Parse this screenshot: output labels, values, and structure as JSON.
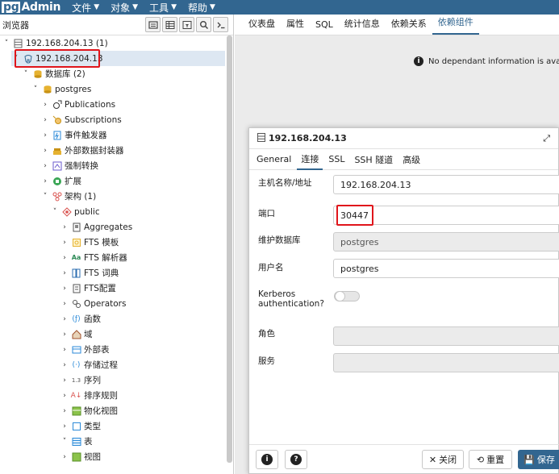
{
  "app": {
    "logo_prefix": "pg",
    "logo_rest": "Admin",
    "menus": [
      "文件",
      "对象",
      "工具",
      "帮助"
    ]
  },
  "browser": {
    "title": "浏览器",
    "tree": [
      {
        "label": "192.168.204.13 (1)",
        "icon": "server-group-icon",
        "level": 0,
        "expanded": true
      },
      {
        "label": "192.168.204.13",
        "icon": "elephant-server-icon",
        "level": 1,
        "expanded": true,
        "selected": true
      },
      {
        "label": "数据库 (2)",
        "icon": "databases-icon",
        "level": 2,
        "expanded": true
      },
      {
        "label": "postgres",
        "icon": "database-icon",
        "level": 3,
        "expanded": true
      },
      {
        "label": "Publications",
        "icon": "publications-icon",
        "level": 4,
        "expanded": false
      },
      {
        "label": "Subscriptions",
        "icon": "subscriptions-icon",
        "level": 4,
        "expanded": false
      },
      {
        "label": "事件触发器",
        "icon": "event-trigger-icon",
        "level": 4,
        "expanded": false
      },
      {
        "label": "外部数据封装器",
        "icon": "foreign-data-wrapper-icon",
        "level": 4,
        "expanded": false
      },
      {
        "label": "强制转换",
        "icon": "cast-icon",
        "level": 4,
        "expanded": false
      },
      {
        "label": "扩展",
        "icon": "extension-icon",
        "level": 4,
        "expanded": false
      },
      {
        "label": "架构 (1)",
        "icon": "schemas-icon",
        "level": 4,
        "expanded": true
      },
      {
        "label": "public",
        "icon": "schema-icon",
        "level": 5,
        "expanded": true
      },
      {
        "label": "Aggregates",
        "icon": "aggregates-icon",
        "level": 6,
        "expanded": false
      },
      {
        "label": "FTS 模板",
        "icon": "fts-template-icon",
        "level": 6,
        "expanded": false
      },
      {
        "label": "FTS 解析器",
        "icon": "fts-parser-icon",
        "level": 6,
        "expanded": false
      },
      {
        "label": "FTS 词典",
        "icon": "fts-dictionary-icon",
        "level": 6,
        "expanded": false
      },
      {
        "label": "FTS配置",
        "icon": "fts-config-icon",
        "level": 6,
        "expanded": false
      },
      {
        "label": "Operators",
        "icon": "operators-icon",
        "level": 6,
        "expanded": false
      },
      {
        "label": "函数",
        "icon": "function-icon",
        "level": 6,
        "expanded": false
      },
      {
        "label": "域",
        "icon": "domain-icon",
        "level": 6,
        "expanded": false
      },
      {
        "label": "外部表",
        "icon": "foreign-table-icon",
        "level": 6,
        "expanded": false
      },
      {
        "label": "存储过程",
        "icon": "procedure-icon",
        "level": 6,
        "expanded": false
      },
      {
        "label": "序列",
        "icon": "sequence-icon",
        "level": 6,
        "expanded": false
      },
      {
        "label": "排序规则",
        "icon": "collation-icon",
        "level": 6,
        "expanded": false
      },
      {
        "label": "物化视图",
        "icon": "materialized-view-icon",
        "level": 6,
        "expanded": false
      },
      {
        "label": "类型",
        "icon": "type-icon",
        "level": 6,
        "expanded": false
      },
      {
        "label": "表",
        "icon": "table-icon",
        "level": 6,
        "expanded": true
      },
      {
        "label": "视图",
        "icon": "view-icon",
        "level": 6,
        "expanded": false
      }
    ]
  },
  "main": {
    "tabs": [
      "仪表盘",
      "属性",
      "SQL",
      "统计信息",
      "依赖关系",
      "依赖组件"
    ],
    "active_tab": "依赖组件",
    "info_message": "No dependant information is availa"
  },
  "dialog": {
    "title": "192.168.204.13",
    "tabs": [
      "General",
      "连接",
      "SSL",
      "SSH 隧道",
      "高级"
    ],
    "active_tab": "连接",
    "fields": {
      "host_label": "主机名称/地址",
      "host_value": "192.168.204.13",
      "port_label": "端口",
      "port_value": "30447",
      "maintenance_db_label": "维护数据库",
      "maintenance_db_value": "postgres",
      "username_label": "用户名",
      "username_value": "postgres",
      "kerberos_label": "Kerberos authentication?",
      "role_label": "角色",
      "role_value": "",
      "service_label": "服务",
      "service_value": ""
    },
    "buttons": {
      "info": "i",
      "help": "?",
      "close": "关闭",
      "reset": "重置",
      "save": "保存"
    }
  },
  "colors": {
    "brand": "#326690",
    "highlight_box": "#e0151b",
    "selected_row": "#dde7f2"
  }
}
